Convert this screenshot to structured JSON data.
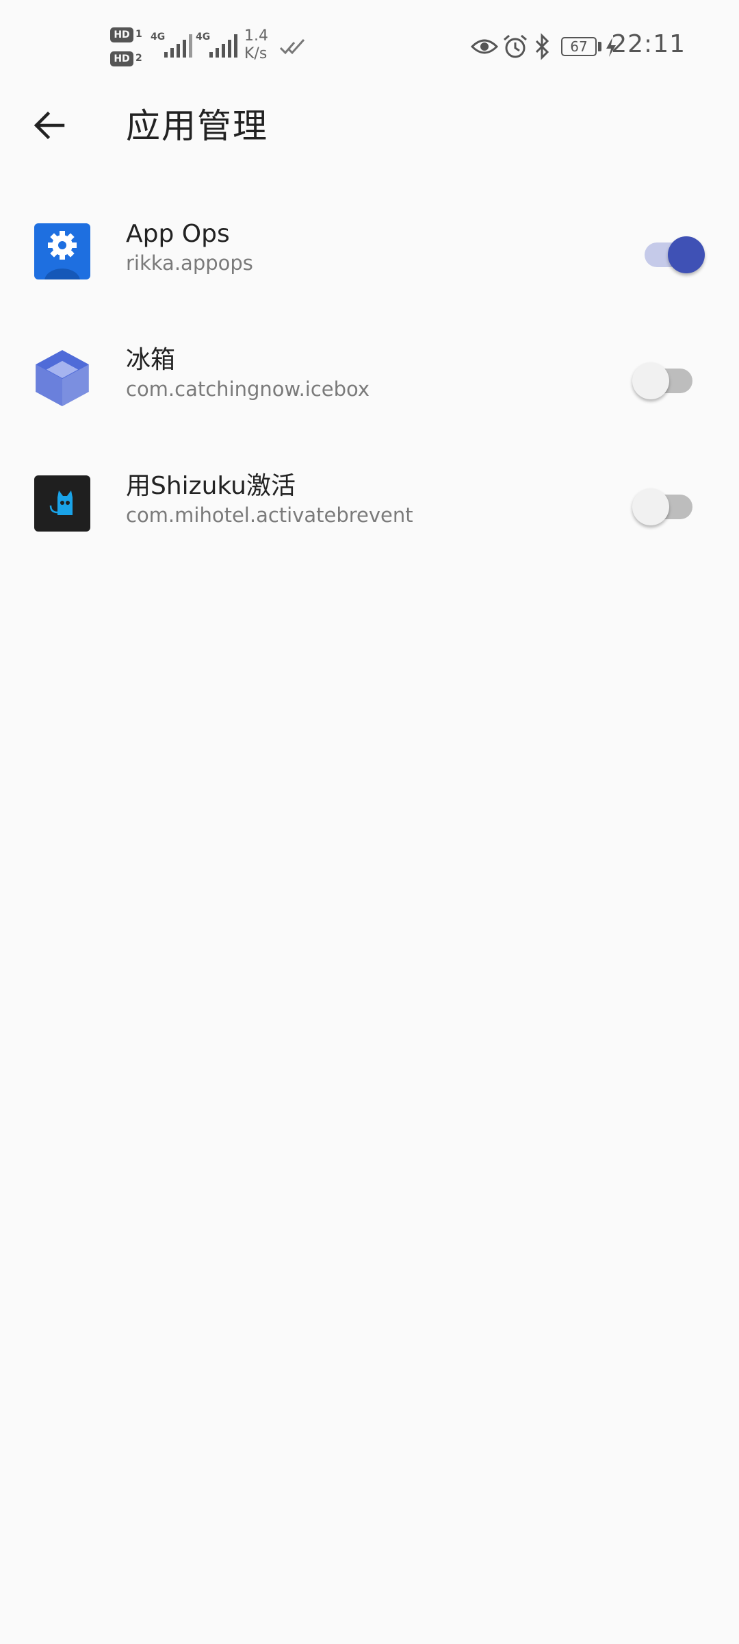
{
  "status_bar": {
    "hd1_label": "HD",
    "hd1_num": "1",
    "hd2_label": "HD",
    "hd2_num": "2",
    "net1": "4G",
    "net2": "4G",
    "speed_value": "1.4",
    "speed_unit": "K/s",
    "battery": "67",
    "time": "22:11",
    "icons": [
      "signal-icon",
      "data-activity-icon",
      "eye-icon",
      "alarm-icon",
      "bluetooth-icon",
      "battery-icon",
      "charging-icon"
    ]
  },
  "toolbar": {
    "title": "应用管理",
    "back_icon": "arrow-back-icon"
  },
  "apps": [
    {
      "name": "App Ops",
      "package": "rikka.appops",
      "enabled": true,
      "icon": "appops-gear-icon"
    },
    {
      "name": "冰箱",
      "package": "com.catchingnow.icebox",
      "enabled": false,
      "icon": "icebox-cube-icon"
    },
    {
      "name": "用Shizuku激活",
      "package": "com.mihotel.activatebrevent",
      "enabled": false,
      "icon": "cat-icon"
    }
  ],
  "colors": {
    "background": "#fafafa",
    "accent": "#3f51b5",
    "accent_track": "#c5cae9",
    "switch_off_track": "#bdbdbd",
    "switch_off_thumb": "#f1f1f1",
    "text_primary": "#222222",
    "text_secondary": "#7a7a7a"
  }
}
